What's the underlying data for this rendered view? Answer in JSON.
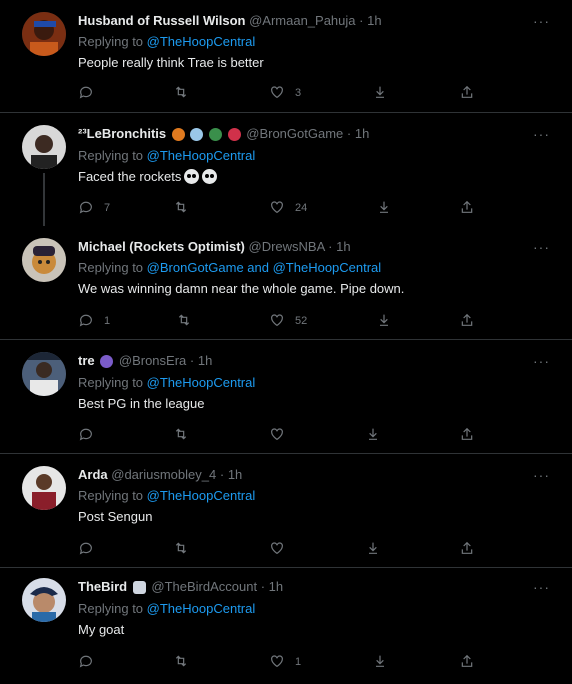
{
  "tweets": [
    {
      "name": "Husband of Russell Wilson",
      "handle": "@Armaan_Pahuja",
      "time": "1h",
      "replying_prefix": "Replying to",
      "replying_to": "@TheHoopCentral",
      "text": "People really think Trae is better",
      "counts": {
        "reply": "",
        "retweet": "",
        "like": "3"
      }
    },
    {
      "name": "²³LeBronchitis",
      "handle": "@BronGotGame",
      "time": "1h",
      "replying_prefix": "Replying to",
      "replying_to": "@TheHoopCentral",
      "text": "Faced the rockets",
      "counts": {
        "reply": "7",
        "retweet": "",
        "like": "24"
      }
    },
    {
      "name": "Michael (Rockets Optimist)",
      "handle": "@DrewsNBA",
      "time": "1h",
      "replying_prefix": "Replying to",
      "replying_to": "@BronGotGame and @TheHoopCentral",
      "text": "We was winning damn near the whole game. Pipe down.",
      "counts": {
        "reply": "1",
        "retweet": "",
        "like": "52"
      }
    },
    {
      "name": "tre",
      "handle": "@BronsEra",
      "time": "1h",
      "replying_prefix": "Replying to",
      "replying_to": "@TheHoopCentral",
      "text": "Best PG in the league",
      "counts": {
        "reply": "",
        "retweet": "",
        "like": ""
      }
    },
    {
      "name": "Arda",
      "handle": "@dariusmobley_4",
      "time": "1h",
      "replying_prefix": "Replying to",
      "replying_to": "@TheHoopCentral",
      "text": "Post Sengun",
      "counts": {
        "reply": "",
        "retweet": "",
        "like": ""
      }
    },
    {
      "name": "TheBird",
      "handle": "@TheBirdAccount",
      "time": "1h",
      "replying_prefix": "Replying to",
      "replying_to": "@TheHoopCentral",
      "text": "My goat",
      "counts": {
        "reply": "",
        "retweet": "",
        "like": "1"
      }
    }
  ],
  "separator": "·",
  "more_glyph": "···",
  "colors": {
    "background": "#000000",
    "link": "#1d9bf0",
    "muted": "#71767b",
    "text": "#e7e9ea",
    "divider": "#2f3336"
  }
}
